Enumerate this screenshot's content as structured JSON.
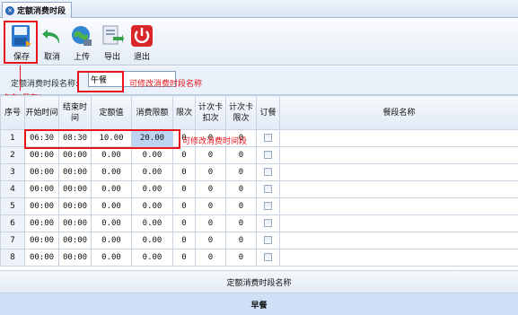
{
  "tab": {
    "title": "定额消费时段"
  },
  "toolbar": {
    "save": "保存",
    "cancel": "取消",
    "upload": "上传",
    "export": "导出",
    "exit": "退出"
  },
  "name_field": {
    "label": "定额消费时段名称:",
    "value": "午餐"
  },
  "annotations": {
    "click_save": "点击\"保存\"",
    "name_editable": "可修改消费时段名称",
    "time_editable": "可修改消费时间段"
  },
  "grid": {
    "columns": [
      "序号",
      "开始时间",
      "结束时间",
      "定额值",
      "消费限额",
      "限次",
      "计次卡扣次",
      "计次卡限次",
      "订餐",
      "餐段名称"
    ],
    "rows": [
      [
        "1",
        "06:30",
        "08:30",
        "10.00",
        "20.00",
        "0",
        "0",
        "0"
      ],
      [
        "2",
        "00:00",
        "00:00",
        "0.00",
        "0.00",
        "0",
        "0",
        "0"
      ],
      [
        "3",
        "00:00",
        "00:00",
        "0.00",
        "0.00",
        "0",
        "0",
        "0"
      ],
      [
        "4",
        "00:00",
        "00:00",
        "0.00",
        "0.00",
        "0",
        "0",
        "0"
      ],
      [
        "5",
        "00:00",
        "00:00",
        "0.00",
        "0.00",
        "0",
        "0",
        "0"
      ],
      [
        "6",
        "00:00",
        "00:00",
        "0.00",
        "0.00",
        "0",
        "0",
        "0"
      ],
      [
        "7",
        "00:00",
        "00:00",
        "0.00",
        "0.00",
        "0",
        "0",
        "0"
      ],
      [
        "8",
        "00:00",
        "00:00",
        "0.00",
        "0.00",
        "0",
        "0",
        "0"
      ]
    ]
  },
  "bottom": {
    "header": "定额消费时段名称",
    "row": "早餐"
  },
  "colors": {
    "highlight": "#e8141b",
    "selected_cell": "#bcd4f2"
  }
}
